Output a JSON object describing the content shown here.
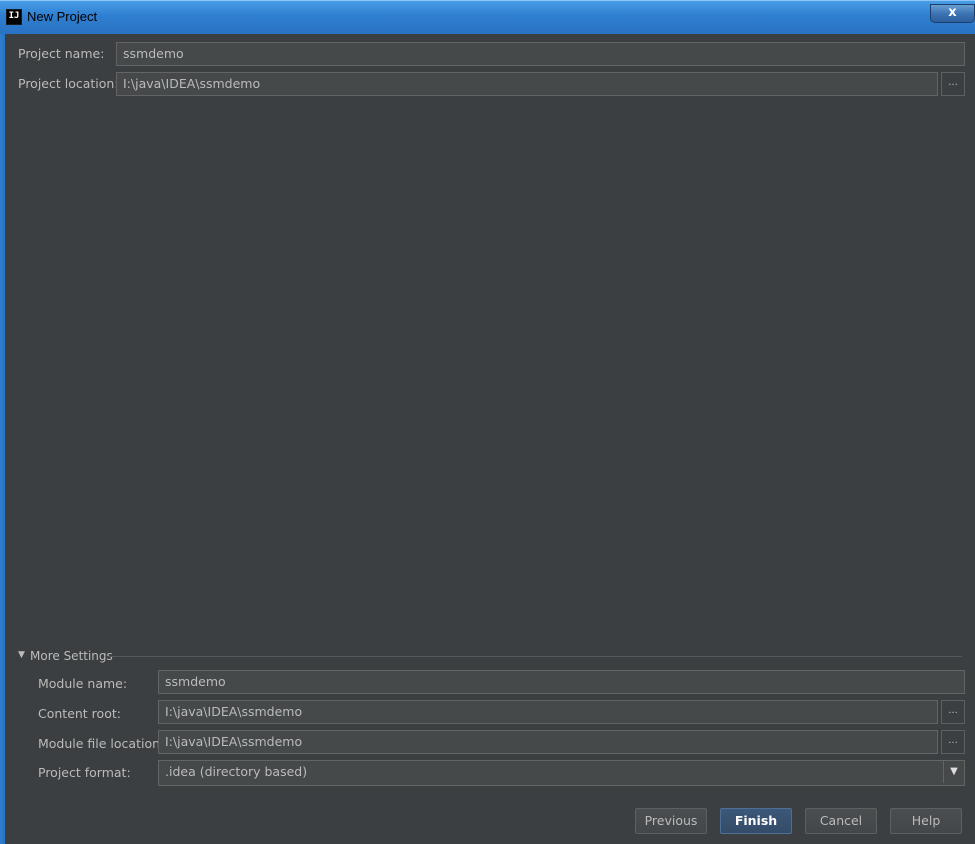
{
  "window": {
    "app_icon_text": "IJ",
    "title": "New Project",
    "close_symbol": "x"
  },
  "project": {
    "name_label": "Project name:",
    "name_value": "ssmdemo",
    "location_label": "Project location:",
    "location_value": "I:\\java\\IDEA\\ssmdemo",
    "browse_label": "..."
  },
  "more_settings": {
    "toggle_label": "More Settings",
    "module_name_label": "Module name:",
    "module_name_value": "ssmdemo",
    "content_root_label": "Content root:",
    "content_root_value": "I:\\java\\IDEA\\ssmdemo",
    "module_file_location_label": "Module file location:",
    "module_file_location_value": "I:\\java\\IDEA\\ssmdemo",
    "project_format_label": "Project format:",
    "project_format_value": ".idea (directory based)",
    "browse_label": "..."
  },
  "buttons": {
    "previous": "Previous",
    "finish": "Finish",
    "cancel": "Cancel",
    "help": "Help"
  },
  "colors": {
    "background": "#3c3f41",
    "titlebar": "#2f7fd0",
    "field_bg": "#45494a",
    "text": "#bbbbbb"
  }
}
